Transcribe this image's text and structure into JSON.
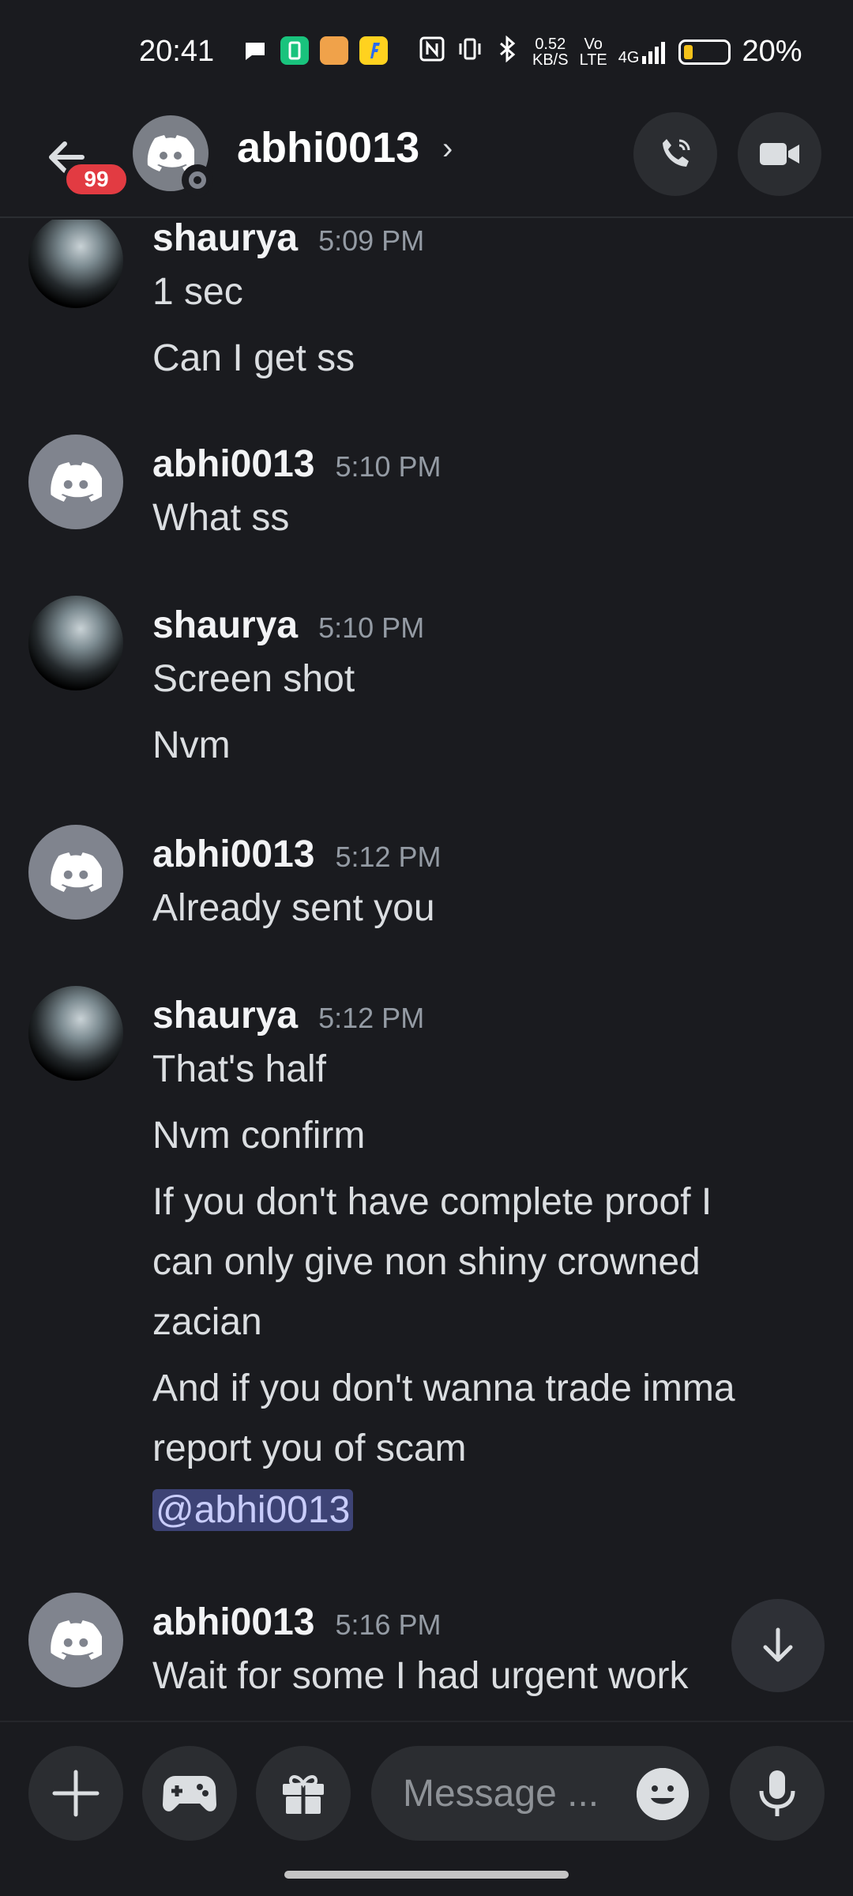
{
  "status_bar": {
    "time": "20:41",
    "net_speed_value": "0.52",
    "net_speed_unit": "KB/S",
    "volte_top": "Vo",
    "volte_bottom": "LTE",
    "network": "4G",
    "battery_percent": "20%",
    "battery_level": 0.2,
    "battery_color": "#f4c21a"
  },
  "header": {
    "unread_badge": "99",
    "title": "abhi0013",
    "chevron": "›"
  },
  "messages": [
    {
      "author": "shaurya",
      "time": "5:09 PM",
      "avatar": "custom-avatar",
      "lines": [
        "1 sec",
        "Can I get ss"
      ]
    },
    {
      "author": "abhi0013",
      "time": "5:10 PM",
      "avatar": "discord-avatar",
      "lines": [
        "What ss"
      ]
    },
    {
      "author": "shaurya",
      "time": "5:10 PM",
      "avatar": "custom-avatar",
      "lines": [
        "Screen shot",
        "Nvm"
      ]
    },
    {
      "author": "abhi0013",
      "time": "5:12 PM",
      "avatar": "discord-avatar",
      "lines": [
        "Already sent you"
      ]
    },
    {
      "author": "shaurya",
      "time": "5:12 PM",
      "avatar": "custom-avatar",
      "lines": [
        "That's half",
        "Nvm confirm",
        "If you don't have complete proof I",
        "can only give non shiny crowned",
        "zacian",
        "And if you don't wanna trade imma",
        "report you of scam"
      ],
      "mention": "@abhi0013"
    },
    {
      "author": "abhi0013",
      "time": "5:16 PM",
      "avatar": "discord-avatar",
      "lines": [
        "Wait for some I had urgent work"
      ]
    }
  ],
  "input": {
    "placeholder": "Message ..."
  },
  "colors": {
    "background": "#1a1b1f",
    "badge": "#e23b42",
    "mention_bg": "#3d4375",
    "button_bg": "#2b2d31"
  }
}
